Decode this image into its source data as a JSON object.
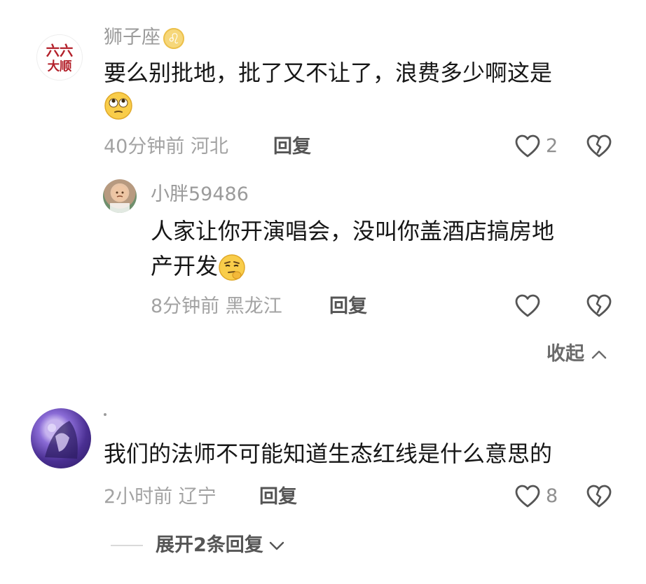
{
  "comments": [
    {
      "username": "狮子座",
      "content_line1": "要么别批地，批了又不让了，浪费多少啊这是",
      "time": "40分钟前",
      "location": "河北",
      "reply_label": "回复",
      "likes": "2",
      "replies": [
        {
          "username": "小胖59486",
          "content_line1": "人家让你开演唱会，没叫你盖酒店搞房地",
          "content_line2": "产开发",
          "time": "8分钟前",
          "location": "黑龙江",
          "reply_label": "回复",
          "likes": ""
        }
      ],
      "collapse_label": "收起"
    },
    {
      "username": ".",
      "content_line1": "我们的法师不可能知道生态红线是什么意思的",
      "time": "2小时前",
      "location": "辽宁",
      "reply_label": "回复",
      "likes": "8",
      "expand_label": "展开2条回复"
    }
  ],
  "avatar_text": {
    "top": "六六",
    "bottom": "大顺"
  },
  "icons": {
    "like": "heart-outline-icon",
    "dislike": "broken-heart-icon",
    "zodiac": "leo-zodiac-icon",
    "emoji_1": "rolling-eyes-emoji",
    "emoji_2": "thinking-face-emoji",
    "collapse": "chevron-up-icon",
    "expand": "chevron-down-icon"
  },
  "colors": {
    "text_primary": "#161616",
    "text_secondary": "#9b9b9b",
    "accent_red": "#b3202a"
  }
}
